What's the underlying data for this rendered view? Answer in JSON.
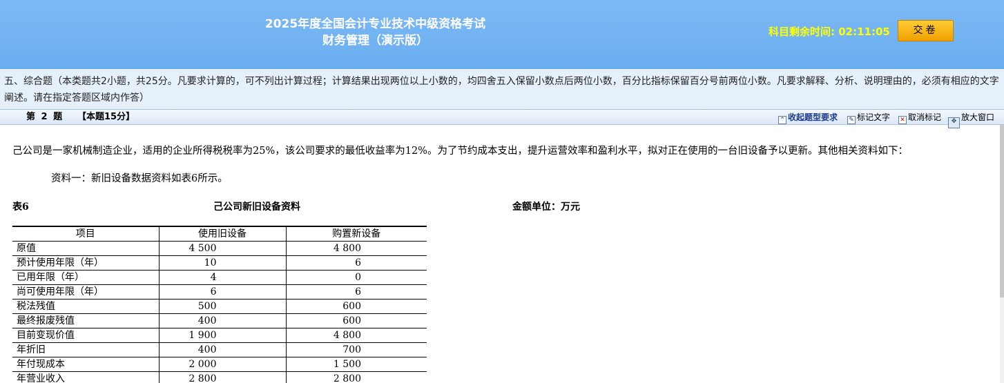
{
  "header": {
    "title_line1": "2025年度全国会计专业技术中级资格考试",
    "title_line2": "财务管理（演示版）",
    "timer_label": "科目剩余时间:",
    "timer_value": "02:11:05",
    "submit_label": "交卷"
  },
  "section": {
    "instructions": "五、综合题（本类题共2小题，共25分。凡要求计算的，可不列出计算过程；计算结果出现两位以上小数的，均四舍五入保留小数点后两位小数，百分比指标保留百分号前两位小数。凡要求解释、分析、说明理由的，必须有相应的文字阐述。请在指定答题区域内作答）"
  },
  "question_bar": {
    "number": "第 2 题",
    "score": "【本题15分】",
    "collapse_label": "收起题型要求",
    "mark_label": "标记文字",
    "unmark_label": "取消标记",
    "enlarge_label": "放大窗口"
  },
  "question": {
    "text": "己公司是一家机械制造企业，适用的企业所得税税率为25%，该公司要求的最低收益率为12%。为了节约成本支出，提升运营效率和盈利水平，拟对正在使用的一台旧设备予以更新。其他相关资料如下：",
    "material_one": "资料一：新旧设备数据资料如表6所示。",
    "table_label": "表6",
    "table_title": "己公司新旧设备资料",
    "table_unit": "金额单位：万元",
    "table": {
      "headers": [
        "项目",
        "使用旧设备",
        "购置新设备"
      ],
      "rows": [
        [
          "原值",
          "4 500",
          "4 800"
        ],
        [
          "预计使用年限（年）",
          "10",
          "6"
        ],
        [
          "已用年限（年）",
          "4",
          "0"
        ],
        [
          "尚可使用年限（年）",
          "6",
          "6"
        ],
        [
          "税法残值",
          "500",
          "600"
        ],
        [
          "最终报废残值",
          "400",
          "600"
        ],
        [
          "目前变现价值",
          "1 900",
          "4 800"
        ],
        [
          "年折旧",
          "400",
          "700"
        ],
        [
          "年付现成本",
          "2 000",
          "1 500"
        ],
        [
          "年营业收入",
          "2 800",
          "2 800"
        ]
      ]
    }
  },
  "colors": {
    "header_bg": "#6aaef0",
    "timer": "#ffff00",
    "submit_button": "#f0a000",
    "section_bg": "#e6f0fb"
  }
}
